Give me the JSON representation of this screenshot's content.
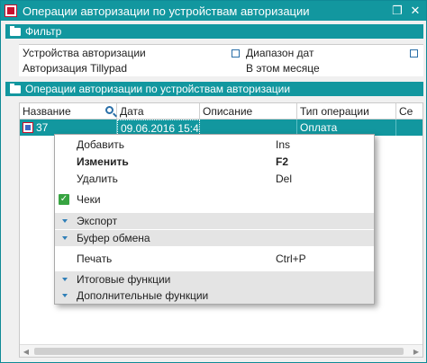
{
  "window": {
    "title": "Операции авторизации по устройствам авторизации",
    "restore_glyph": "❐",
    "close_glyph": "✕"
  },
  "filter": {
    "section_label": "Фильтр",
    "col1_header": "Устройства авторизации",
    "col1_value": "Авторизация Tillypad",
    "col2_header": "Диапазон дат",
    "col2_value": "В этом месяце"
  },
  "grid": {
    "section_label": "Операции авторизации по устройствам авторизации",
    "columns": [
      "Название",
      "Дата",
      "Описание",
      "Тип операции",
      "Се"
    ],
    "rows": [
      {
        "name": "37",
        "date": "09.06.2016 15:4",
        "description": "",
        "op_type": "Оплата"
      }
    ]
  },
  "context_menu": {
    "items": [
      {
        "label": "Добавить",
        "shortcut": "Ins"
      },
      {
        "label": "Изменить",
        "shortcut": "F2"
      },
      {
        "label": "Удалить",
        "shortcut": "Del"
      },
      {
        "label": "Чеки",
        "shortcut": "",
        "checked": true
      },
      {
        "label": "Экспорт",
        "shortcut": ""
      },
      {
        "label": "Буфер обмена",
        "shortcut": ""
      },
      {
        "label": "Печать",
        "shortcut": "Ctrl+P"
      },
      {
        "label": "Итоговые функции",
        "shortcut": ""
      },
      {
        "label": "Дополнительные функции",
        "shortcut": ""
      }
    ],
    "check_glyph": "✓"
  },
  "colors": {
    "accent": "#12979f",
    "brand_red": "#c8102e"
  },
  "icons": {
    "title": "app-window-icon",
    "section": "folder-icon",
    "search": "search-icon",
    "row": "document-icon"
  }
}
